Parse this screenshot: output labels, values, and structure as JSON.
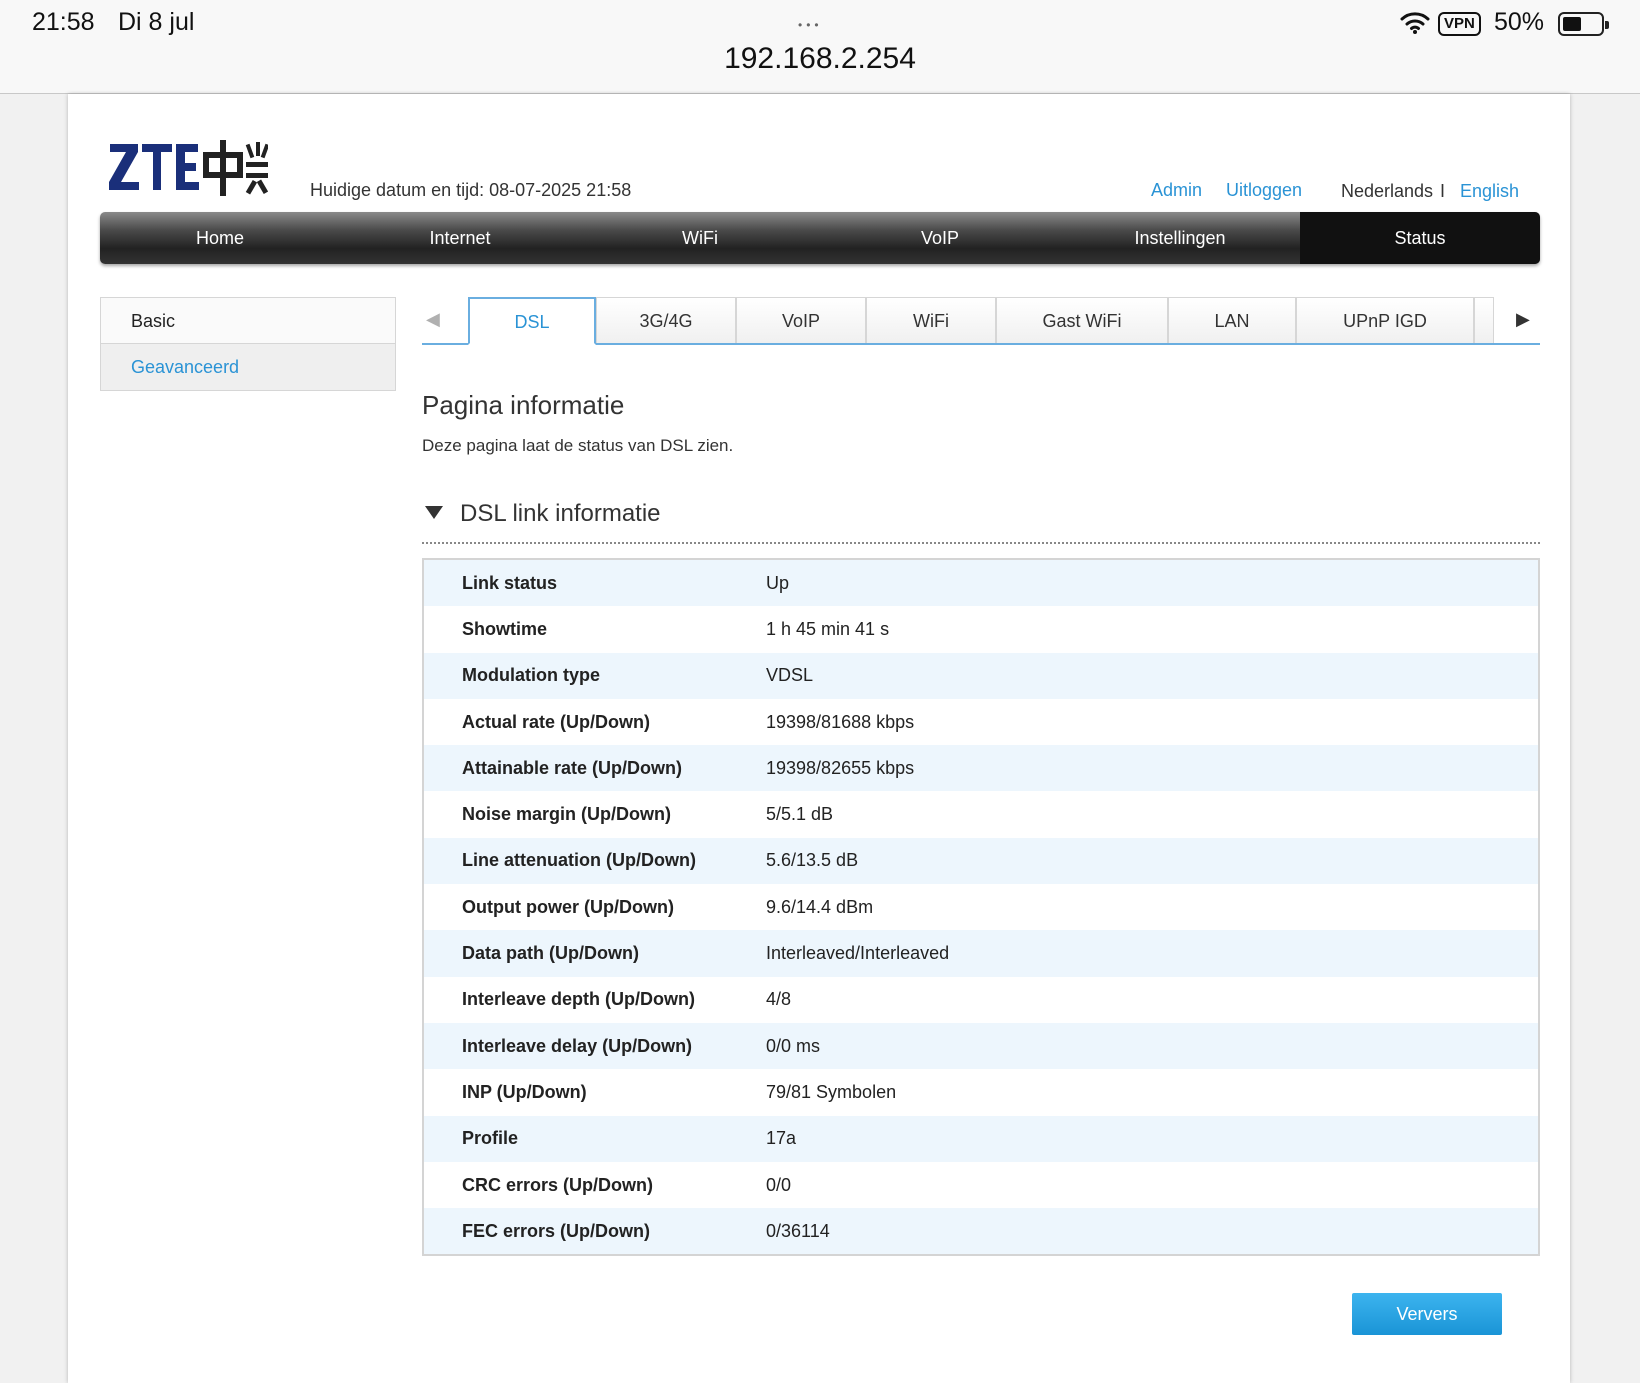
{
  "statusbar": {
    "time": "21:58",
    "date": "Di 8 jul",
    "dots": "•••",
    "url": "192.168.2.254",
    "vpn": "VPN",
    "battery_pct": "50%",
    "battery_level": 0.5
  },
  "header": {
    "datetime": "Huidige datum en tijd: 08-07-2025 21:58",
    "admin": "Admin",
    "logout": "Uitloggen",
    "lang_nl": "Nederlands",
    "lang_sep": "I",
    "lang_en": "English"
  },
  "mainnav": [
    "Home",
    "Internet",
    "WiFi",
    "VoIP",
    "Instellingen",
    "Status"
  ],
  "sidemenu": [
    "Basic",
    "Geavanceerd"
  ],
  "subtabs": [
    "DSL",
    "3G/4G",
    "VoIP",
    "WiFi",
    "Gast WiFi",
    "LAN",
    "UPnP IGD"
  ],
  "page": {
    "title": "Pagina informatie",
    "description": "Deze pagina laat de status van DSL zien."
  },
  "section": {
    "title": "DSL link informatie",
    "rows": [
      {
        "label": "Link status",
        "value": "Up"
      },
      {
        "label": "Showtime",
        "value": "1 h 45 min 41 s"
      },
      {
        "label": "Modulation type",
        "value": "VDSL"
      },
      {
        "label": "Actual rate (Up/Down)",
        "value": "19398/81688 kbps"
      },
      {
        "label": "Attainable rate (Up/Down)",
        "value": "19398/82655 kbps"
      },
      {
        "label": "Noise margin (Up/Down)",
        "value": "5/5.1 dB"
      },
      {
        "label": "Line attenuation (Up/Down)",
        "value": "5.6/13.5 dB"
      },
      {
        "label": "Output power (Up/Down)",
        "value": "9.6/14.4 dBm"
      },
      {
        "label": "Data path (Up/Down)",
        "value": "Interleaved/Interleaved"
      },
      {
        "label": "Interleave depth (Up/Down)",
        "value": "4/8"
      },
      {
        "label": "Interleave delay (Up/Down)",
        "value": "0/0 ms"
      },
      {
        "label": "INP (Up/Down)",
        "value": "79/81 Symbolen"
      },
      {
        "label": "Profile",
        "value": "17a"
      },
      {
        "label": "CRC errors (Up/Down)",
        "value": "0/0"
      },
      {
        "label": "FEC errors (Up/Down)",
        "value": "0/36114"
      }
    ]
  },
  "buttons": {
    "refresh": "Ververs"
  },
  "colors": {
    "accent": "#2a93d5",
    "row_alt": "#edf6fd",
    "nav_active": "#111111"
  }
}
